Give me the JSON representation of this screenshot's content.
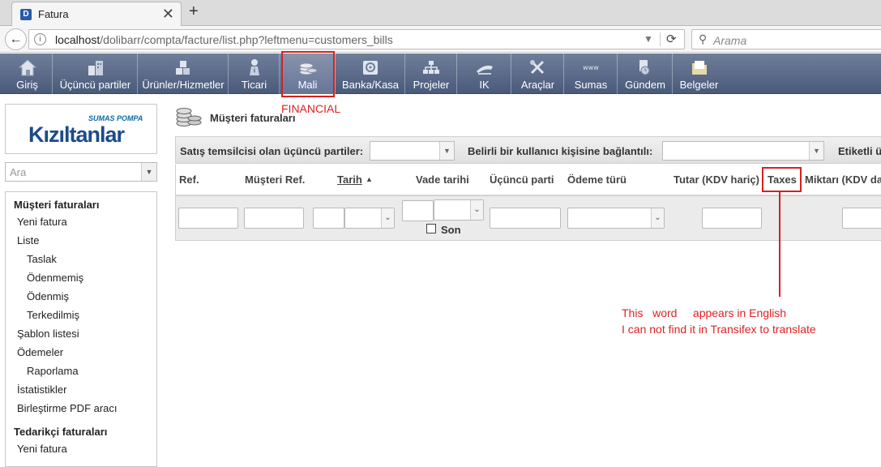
{
  "browser": {
    "tab_title": "Fatura",
    "tab_close": "✕",
    "new_tab": "+",
    "url_host": "localhost",
    "url_path": "/dolibarr/compta/facture/list.php?leftmenu=customers_bills",
    "search_placeholder": "Arama"
  },
  "topmenu": {
    "items": [
      {
        "label": "Giriş",
        "icon": "home-icon"
      },
      {
        "label": "Üçüncü partiler",
        "icon": "company-icon"
      },
      {
        "label": "Ürünler/Hizmetler",
        "icon": "products-icon"
      },
      {
        "label": "Ticari",
        "icon": "commercial-icon"
      },
      {
        "label": "Mali",
        "icon": "coins-icon"
      },
      {
        "label": "Banka/Kasa",
        "icon": "bank-icon"
      },
      {
        "label": "Projeler",
        "icon": "projects-icon"
      },
      {
        "label": "IK",
        "icon": "hrm-icon"
      },
      {
        "label": "Araçlar",
        "icon": "tools-icon"
      },
      {
        "label": "Sumas",
        "icon": "module-icon"
      },
      {
        "label": "Gündem",
        "icon": "agenda-icon"
      },
      {
        "label": "Belgeler",
        "icon": "documents-icon"
      }
    ]
  },
  "annotations": {
    "financial": "FINANCIAL",
    "note_line1": "This   word     appears in English",
    "note_line2": "I can not find it in Transifex to translate",
    "color": "#e02222"
  },
  "logo": {
    "top": "SUMAS POMPA",
    "main": "Kızıltanlar"
  },
  "leftsearch": {
    "placeholder": "Ara"
  },
  "leftmenu": {
    "customer_invoices": "Müşteri faturaları",
    "new_invoice": "Yeni fatura",
    "list": "Liste",
    "draft": "Taslak",
    "unpaid": "Ödenmemiş",
    "paid": "Ödenmiş",
    "abandoned": "Terkedilmiş",
    "templates": "Şablon listesi",
    "payments": "Ödemeler",
    "reporting": "Raporlama",
    "statistics": "İstatistikler",
    "pdf_merge": "Birleştirme PDF aracı",
    "supplier_invoices": "Tedarikçi faturaları",
    "new_invoice_2": "Yeni fatura"
  },
  "main": {
    "title": "Müşteri faturaları",
    "filter_sales_rep": "Satış temsilcisi olan üçüncü partiler:",
    "filter_user_linked": "Belirli bir kullanıcı kişisine bağlantılı:",
    "filter_tag": "Etiketli ü",
    "columns": {
      "ref": "Ref.",
      "customer_ref": "Müşteri Ref.",
      "date": "Tarih",
      "sort_indicator": "▲",
      "due_date": "Vade tarihi",
      "third_party": "Üçüncü parti",
      "payment_type": "Ödeme türü",
      "amount_ht": "Tutar (KDV hariç)",
      "taxes": "Taxes",
      "amount_ttc": "Miktarı (KDV da"
    },
    "son_label": "Son"
  }
}
